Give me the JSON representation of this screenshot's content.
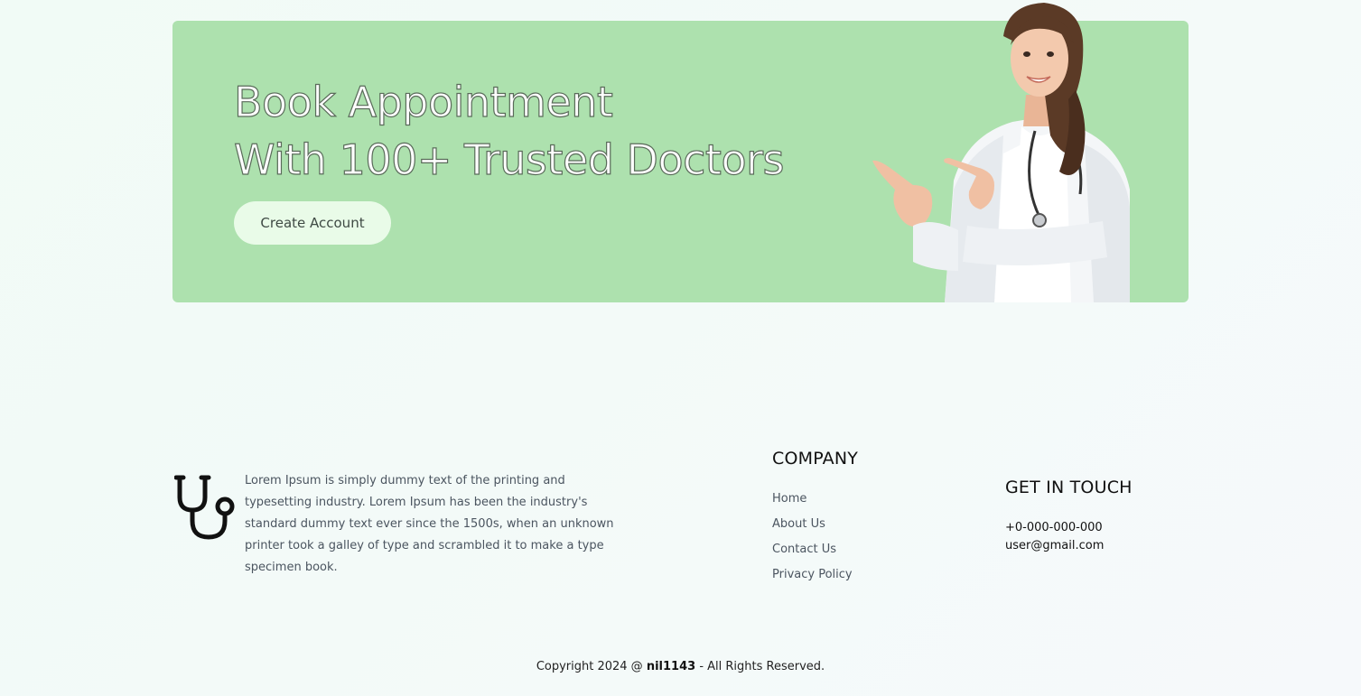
{
  "banner": {
    "line1": "Book Appointment",
    "line2": "With 100+ Trusted Doctors",
    "cta_label": "Create Account",
    "background_color": "#ade1ae"
  },
  "footer": {
    "logo_icon": "stethoscope-icon",
    "description": "Lorem Ipsum is simply dummy text of the printing and typesetting industry. Lorem Ipsum has been the industry's standard dummy text ever since the 1500s, when an unknown printer took a galley of type and scrambled it to make a type specimen book.",
    "company": {
      "title": "COMPANY",
      "links": [
        "Home",
        "About Us",
        "Contact Us",
        "Privacy Policy"
      ]
    },
    "contact": {
      "title": "GET IN TOUCH",
      "phone": "+0-000-000-000",
      "email": "user@gmail.com"
    },
    "copyright": {
      "prefix": "Copyright 2024 @ ",
      "brand": "nil1143",
      "suffix": " - All Rights Reserved."
    }
  }
}
